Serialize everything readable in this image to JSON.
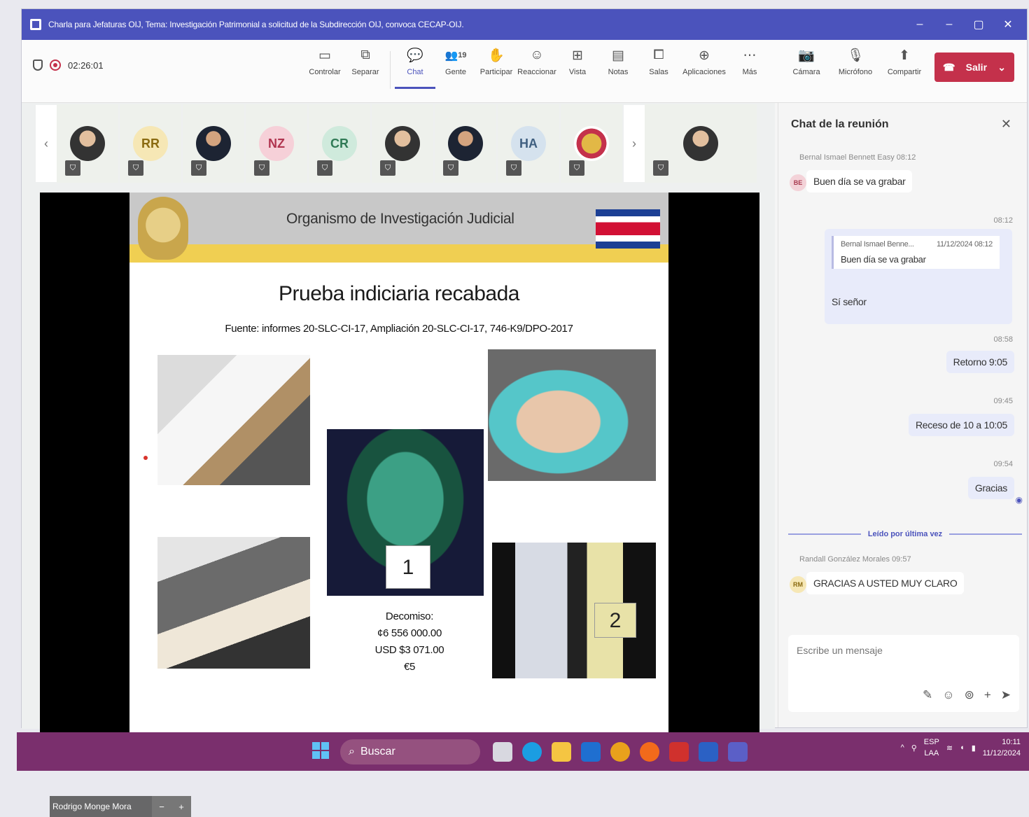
{
  "window": {
    "title": "Charla para Jefaturas OIJ, Tema: Investigación Patrimonial a solicitud de la Subdirección OIJ, convoca CECAP-OIJ.",
    "controls": [
      "–",
      "–",
      "▢",
      "✕"
    ]
  },
  "toolbar": {
    "timer": "02:26:01",
    "tools": [
      {
        "label": "Controlar",
        "icon": "share-tray-icon",
        "glyph": "▭"
      },
      {
        "label": "Separar",
        "icon": "pop-out-icon",
        "glyph": "⧉"
      },
      {
        "label": "Chat",
        "icon": "chat-icon",
        "glyph": "💬"
      },
      {
        "label": "Gente",
        "icon": "people-icon",
        "glyph": "👥"
      },
      {
        "label": "Participar",
        "icon": "raise-hand-icon",
        "glyph": "✋"
      },
      {
        "label": "Reaccionar",
        "icon": "react-icon",
        "glyph": "☺"
      },
      {
        "label": "Vista",
        "icon": "view-icon",
        "glyph": "⊞"
      },
      {
        "label": "Notas",
        "icon": "notes-icon",
        "glyph": "▤"
      },
      {
        "label": "Salas",
        "icon": "rooms-icon",
        "glyph": "⧠"
      },
      {
        "label": "Aplicaciones",
        "icon": "apps-icon",
        "glyph": "⊕"
      },
      {
        "label": "Más",
        "icon": "more-icon",
        "glyph": "⋯"
      }
    ],
    "people_count": "19",
    "media": [
      {
        "label": "Cámara",
        "icon": "camera-off-icon",
        "glyph": "📷"
      },
      {
        "label": "Micrófono",
        "icon": "mic-off-icon",
        "glyph": "🎙"
      },
      {
        "label": "Compartir",
        "icon": "share-icon",
        "glyph": "⬆"
      }
    ],
    "leave_label": "Salir"
  },
  "participants": [
    {
      "initials": "",
      "kind": "photo"
    },
    {
      "initials": "RR",
      "kind": "initials",
      "bg": "#f6e7b5",
      "fg": "#8a6a10"
    },
    {
      "initials": "",
      "kind": "photo2"
    },
    {
      "initials": "NZ",
      "kind": "initials",
      "bg": "#f6d0d8",
      "fg": "#b0344f"
    },
    {
      "initials": "CR",
      "kind": "initials",
      "bg": "#cfeadc",
      "fg": "#2f7a55"
    },
    {
      "initials": "",
      "kind": "photo"
    },
    {
      "initials": "",
      "kind": "photo2"
    },
    {
      "initials": "HA",
      "kind": "initials",
      "bg": "#d5e2ee",
      "fg": "#3f5f80"
    },
    {
      "initials": "",
      "kind": "badge"
    },
    {
      "initials": "",
      "kind": "photo"
    }
  ],
  "slide": {
    "org": "Organismo de Investigación Judicial",
    "title": "Prueba indiciaria recabada",
    "source": "Fuente: informes 20-SLC-CI-17, Ampliación 20-SLC-CI-17, 746-K9/DPO-2017",
    "seizure_lines": [
      "Decomiso:",
      "¢6 556 000.00",
      "USD $3 071.00",
      "€5"
    ],
    "tag1": "1",
    "tag2": "2"
  },
  "speaker": {
    "name": "Rodrigo Monge Mora"
  },
  "chat": {
    "header": "Chat de la reunión",
    "messages": [
      {
        "meta": "Bernal Ismael Bennett Easy 08:12",
        "avatar": "BE",
        "text": "Buen día se va grabar"
      },
      {
        "time": "08:12",
        "quote_author": "Bernal Ismael Benne...",
        "quote_time": "11/12/2024 08:12",
        "quote_text": "Buen día se va grabar",
        "text": "Sí señor"
      },
      {
        "time": "08:58",
        "text": "Retorno 9:05"
      },
      {
        "time": "09:45",
        "text": "Receso de 10 a 10:05"
      },
      {
        "time": "09:54",
        "text": "Gracias"
      },
      {
        "meta": "Randall González Morales 09:57",
        "avatar": "RM",
        "text": "GRACIAS A USTED MUY CLARO"
      }
    ],
    "read_marker": "Leído por última vez",
    "composer_placeholder": "Escribe un mensaje"
  },
  "taskbar": {
    "search_label": "Buscar",
    "lang_line1": "ESP",
    "lang_line2": "LAA",
    "time": "10:11",
    "date": "11/12/2024"
  }
}
